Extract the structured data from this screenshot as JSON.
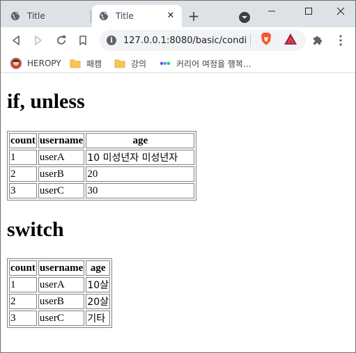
{
  "browser": {
    "tabs": [
      {
        "title": "Title",
        "active": false
      },
      {
        "title": "Title",
        "active": true
      }
    ],
    "url": "127.0.0.1:8080/basic/condi...",
    "bookmarks": [
      {
        "label": "HEROPY",
        "icon": "avatar-icon"
      },
      {
        "label": "패캠",
        "icon": "folder-icon"
      },
      {
        "label": "강의",
        "icon": "folder-icon"
      },
      {
        "label": "커리어 여정을 행복...",
        "icon": "dots-logo-icon"
      }
    ],
    "folder_color": "#f9c74f"
  },
  "page": {
    "if_section": {
      "heading": "if, unless",
      "headers": [
        "count",
        "username",
        "age"
      ],
      "rows": [
        [
          "1",
          "userA",
          "10 미성년자 미성년자"
        ],
        [
          "2",
          "userB",
          "20"
        ],
        [
          "3",
          "userC",
          "30"
        ]
      ]
    },
    "switch_section": {
      "heading": "switch",
      "headers": [
        "count",
        "username",
        "age"
      ],
      "rows": [
        [
          "1",
          "userA",
          "10살"
        ],
        [
          "2",
          "userB",
          "20살"
        ],
        [
          "3",
          "userC",
          "기타"
        ]
      ]
    }
  }
}
